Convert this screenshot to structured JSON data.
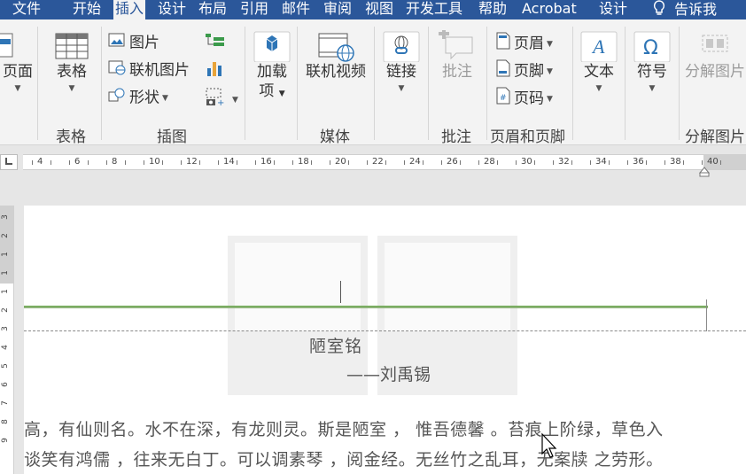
{
  "tabs": [
    {
      "key": "file",
      "label": "文件"
    },
    {
      "key": "home",
      "label": "开始"
    },
    {
      "key": "insert",
      "label": "插入"
    },
    {
      "key": "design",
      "label": "设计"
    },
    {
      "key": "layout",
      "label": "布局"
    },
    {
      "key": "references",
      "label": "引用"
    },
    {
      "key": "mailings",
      "label": "邮件"
    },
    {
      "key": "review",
      "label": "审阅"
    },
    {
      "key": "view",
      "label": "视图"
    },
    {
      "key": "developer",
      "label": "开发工具"
    },
    {
      "key": "help",
      "label": "帮助"
    },
    {
      "key": "acrobat",
      "label": "Acrobat"
    },
    {
      "key": "design2",
      "label": "设计"
    },
    {
      "key": "tellme",
      "label": "告诉我"
    }
  ],
  "ribbon": {
    "pages": {
      "label": "页面"
    },
    "table": {
      "label": "表格",
      "group": "表格"
    },
    "illustrations": {
      "picture": "图片",
      "online_picture": "联机图片",
      "shapes": "形状",
      "group": "插图"
    },
    "addins": {
      "label1": "加载",
      "label2": "项"
    },
    "media": {
      "label": "联机视频",
      "group": "媒体"
    },
    "links": {
      "label": "链接"
    },
    "comments": {
      "label": "批注",
      "group": "批注"
    },
    "header_footer": {
      "header": "页眉",
      "footer": "页脚",
      "page_number": "页码",
      "group": "页眉和页脚"
    },
    "text": {
      "label": "文本"
    },
    "symbols": {
      "label": "符号"
    },
    "decompose": {
      "label": "分解图片",
      "group": "分解图片"
    }
  },
  "ruler": {
    "numbers": [
      "4",
      "6",
      "8",
      "10",
      "12",
      "14",
      "16",
      "18",
      "20",
      "22",
      "24",
      "26",
      "28",
      "30",
      "32",
      "34",
      "36",
      "38",
      "40"
    ],
    "vnumbers": [
      "3",
      "2",
      "1",
      "1",
      "1",
      "2",
      "3",
      "4",
      "5",
      "6",
      "7",
      "8",
      "9"
    ]
  },
  "document": {
    "title": "陋室铭",
    "author": "——刘禹锡",
    "line1": "高，有仙则名。水不在深，有龙则灵。斯是陋室 ， 惟吾德馨 。苔痕上阶绿，草色入",
    "line2": "谈笑有鸿儒 ，往来无白丁。可以调素琴 ，阅金经。无丝竹之乱耳，无案牍 之劳形。"
  },
  "colors": {
    "tab_bar": "#2b579a",
    "ribbon_bg": "#f3f3f3",
    "header_line": "#6aa84f",
    "icon_blue": "#2e75b6"
  }
}
